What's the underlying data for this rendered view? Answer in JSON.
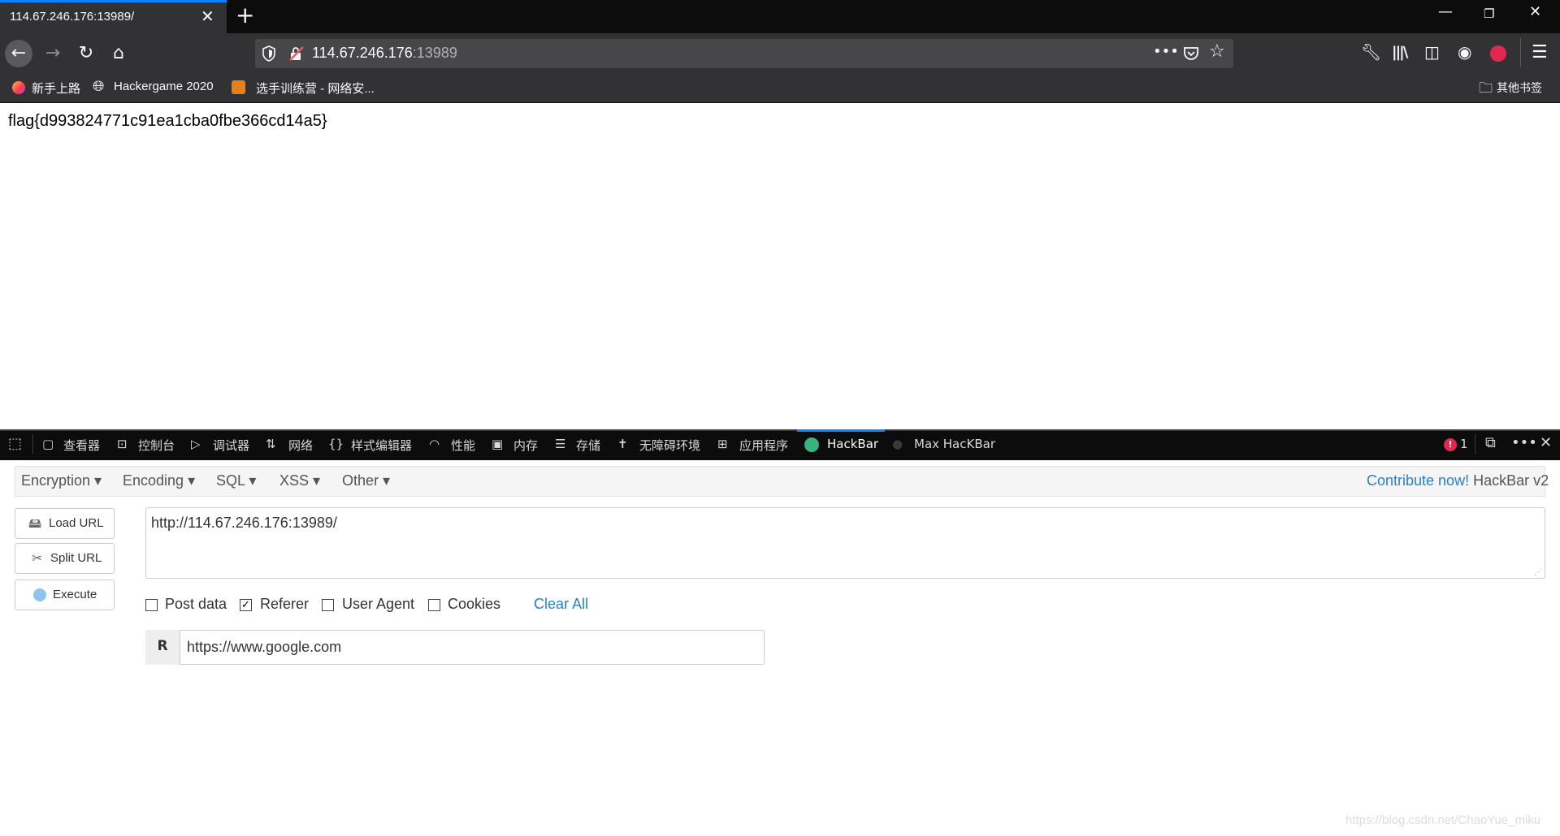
{
  "browser": {
    "tab_title": "114.67.246.176:13989/",
    "address_host": "114.67.246.176",
    "address_port": ":13989"
  },
  "bookmarks": {
    "items": [
      "新手上路",
      "Hackergame 2020",
      "选手训练营 - 网络安..."
    ],
    "other": "其他书签"
  },
  "page": {
    "flag": "flag{d993824771c91ea1cba0fbe366cd14a5}"
  },
  "devtools": {
    "tabs": [
      "查看器",
      "控制台",
      "调试器",
      "网络",
      "样式编辑器",
      "性能",
      "内存",
      "存储",
      "无障碍环境",
      "应用程序",
      "HackBar",
      "Max HacKBar"
    ],
    "error_count": "1"
  },
  "hackbar": {
    "menu": [
      "Encryption",
      "Encoding",
      "SQL",
      "XSS",
      "Other"
    ],
    "contribute": "Contribute now!",
    "version": "HackBar v2",
    "buttons": [
      "Load URL",
      "Split URL",
      "Execute"
    ],
    "url_value": "http://114.67.246.176:13989/",
    "options": [
      {
        "label": "Post data",
        "checked": false
      },
      {
        "label": "Referer",
        "checked": true
      },
      {
        "label": "User Agent",
        "checked": false
      },
      {
        "label": "Cookies",
        "checked": false
      }
    ],
    "clear_all": "Clear All",
    "referer_prefix": "R",
    "referer_value": "https://www.google.com"
  },
  "watermark": "https://blog.csdn.net/ChaoYue_miku",
  "colors": {
    "accent": "#0a84ff",
    "link": "#2a7fc9",
    "toolbar": "#323234",
    "tabstrip": "#0c0c0d"
  }
}
